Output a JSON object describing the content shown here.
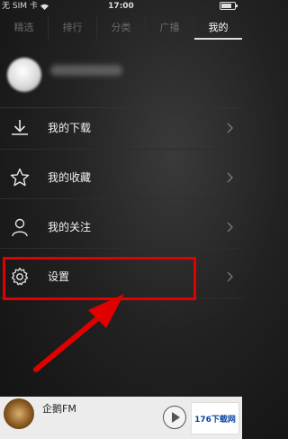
{
  "status_bar": {
    "carrier": "无 SIM 卡",
    "time": "17:00",
    "battery_level": 0.8
  },
  "tabs": [
    {
      "label": "精选",
      "active": false
    },
    {
      "label": "排行",
      "active": false
    },
    {
      "label": "分类",
      "active": false
    },
    {
      "label": "广播",
      "active": false
    },
    {
      "label": "我的",
      "active": true
    }
  ],
  "menu": {
    "items": [
      {
        "label": "我的下载",
        "icon": "download-icon"
      },
      {
        "label": "我的收藏",
        "icon": "star-icon"
      },
      {
        "label": "我的关注",
        "icon": "person-icon"
      },
      {
        "label": "设置",
        "icon": "gear-icon"
      }
    ]
  },
  "player": {
    "title": "企鹅FM"
  },
  "watermark": {
    "text": "176下载网"
  },
  "colors": {
    "highlight": "#e00000",
    "background": "#222222",
    "player_bg": "#ececec"
  }
}
